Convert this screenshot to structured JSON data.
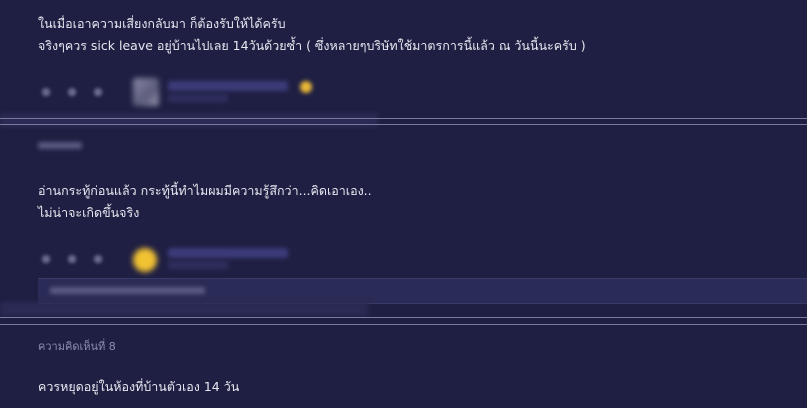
{
  "comment_top": {
    "line1": "ในเมื่อเอาความเสี่ยงกลับมา ก็ต้องรับให้ได้ครับ",
    "line2": "จริงๆควร sick leave อยู่บ้านไปเลย 14วันด้วยซ้ำ ( ซึ่งหลายๆบริษัทใช้มาตรการนี้แล้ว ณ วันนี้นะครับ )"
  },
  "comment_reply": {
    "line1": "อ่านกระทู้ก่อนแล้ว กระทู้นี้ทำไมผมมีความรู้สึกว่า...คิดเอาเอง..",
    "line2": "ไม่น่าจะเกิดขึ้นจริง"
  },
  "comment_8": {
    "label": "ความคิดเห็นที่ 8",
    "text": "ควรหยุดอยู่ในห้องที่บ้านตัวเอง 14 วัน"
  },
  "icons": {
    "like": "thumbs-up-icon",
    "emote": "smile-icon",
    "more": "more-icon"
  }
}
